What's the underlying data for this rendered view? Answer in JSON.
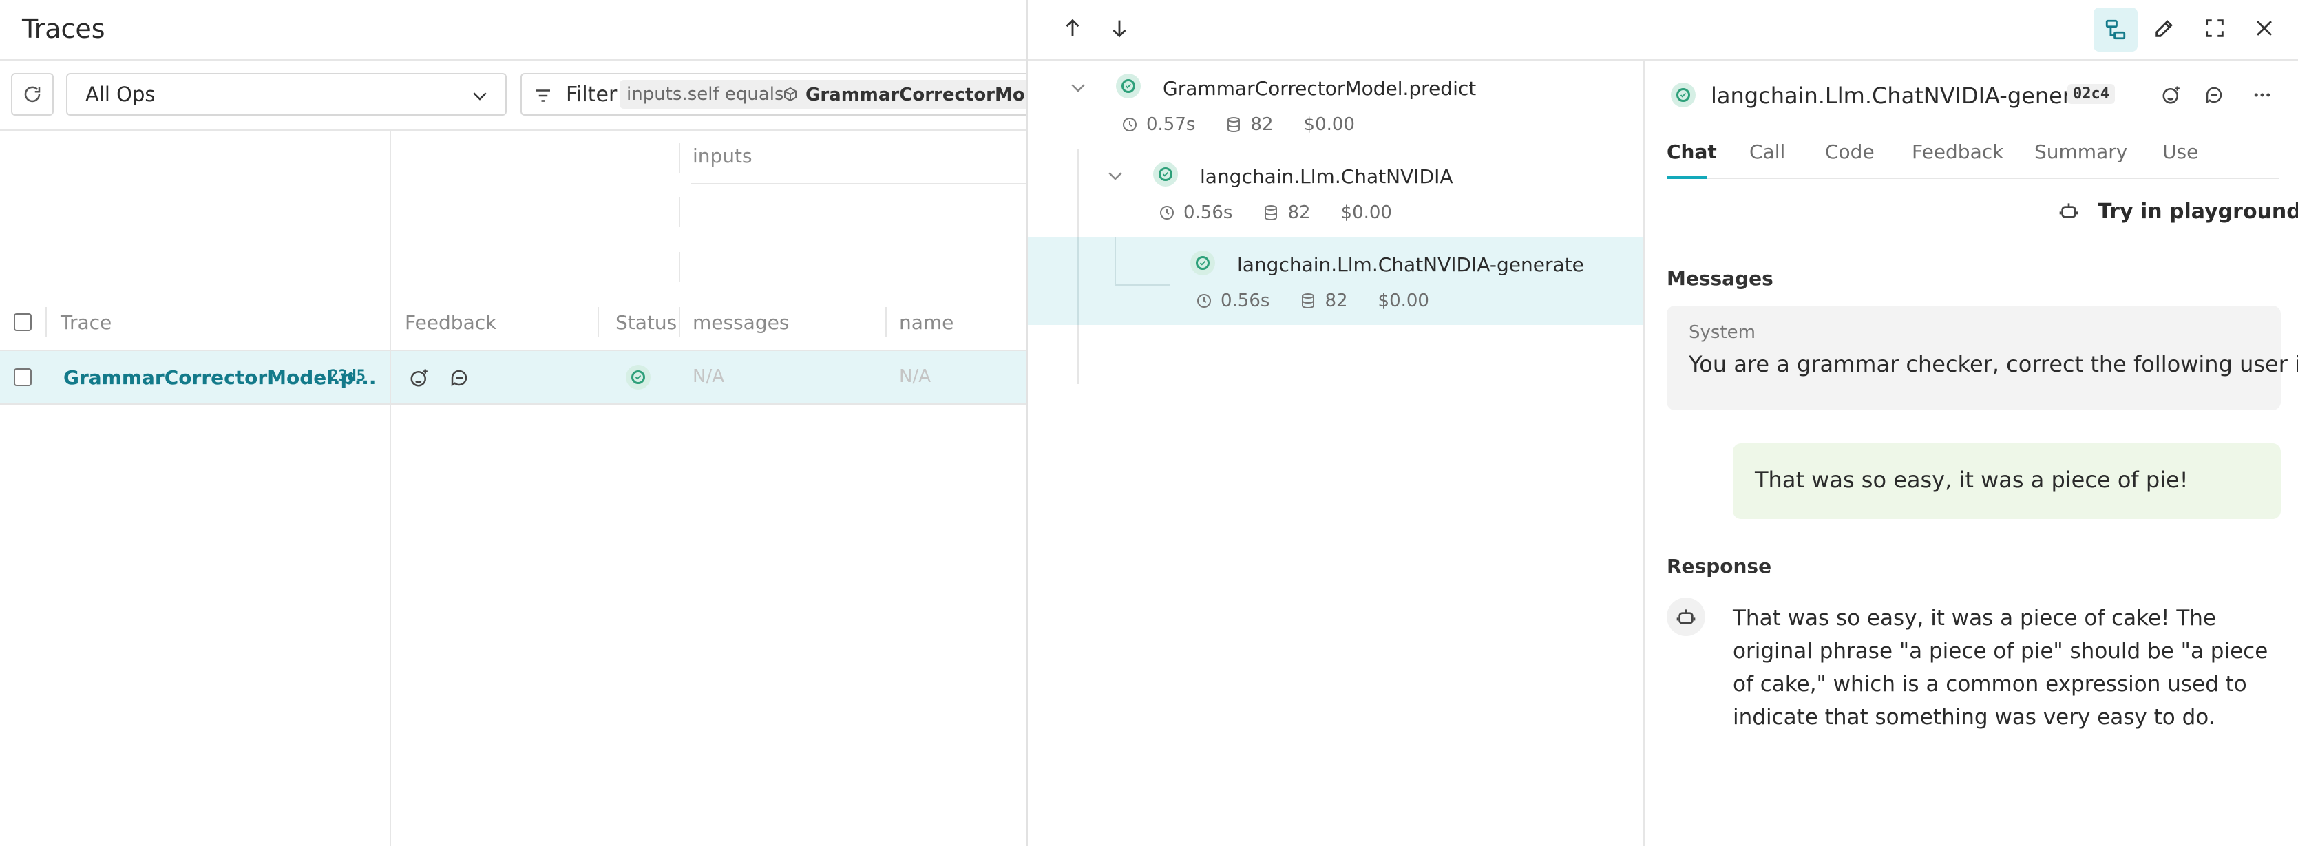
{
  "header": {
    "title": "Traces"
  },
  "toolbar": {
    "op_select": "All Ops",
    "filter_label": "Filter",
    "filter_chip_field": "inputs.self equals",
    "filter_chip_value": "GrammarCorrectorModel"
  },
  "table": {
    "group_header": "inputs",
    "columns": {
      "trace": "Trace",
      "feedback": "Feedback",
      "status": "Status",
      "messages": "messages",
      "name": "name"
    },
    "rows": [
      {
        "trace": "GrammarCorrectorModel.p...",
        "id": "23d5",
        "messages": "N/A",
        "name": "N/A"
      }
    ]
  },
  "tree": {
    "nodes": [
      {
        "label": "GrammarCorrectorModel.predict",
        "duration": "0.57s",
        "tokens": "82",
        "cost": "$0.00"
      },
      {
        "label": "langchain.Llm.ChatNVIDIA",
        "duration": "0.56s",
        "tokens": "82",
        "cost": "$0.00"
      },
      {
        "label": "langchain.Llm.ChatNVIDIA-generate",
        "duration": "0.56s",
        "tokens": "82",
        "cost": "$0.00"
      }
    ]
  },
  "detail": {
    "title": "langchain.Llm.ChatNVIDIA-generate",
    "id": "02c4",
    "tabs": [
      "Chat",
      "Call",
      "Code",
      "Feedback",
      "Summary",
      "Use"
    ],
    "active_tab": "Chat",
    "playground_button": "Try in playground",
    "messages_heading": "Messages",
    "system_label": "System",
    "system_text": "You are a grammar checker, correct the following user input.",
    "user_text": "That was so easy, it was a piece of pie!",
    "response_heading": "Response",
    "response_text": "That was so easy, it was a piece of cake! The original phrase \"a piece of pie\" should be \"a piece of cake,\" which is a common expression used to indicate that something was very easy to do."
  },
  "colors": {
    "accent": "#13a9ba",
    "success": "#2ea07a",
    "highlight": "#e4f5f7",
    "user_bubble": "#eef7e8"
  },
  "icons": [
    "refresh-icon",
    "chevron-down-icon",
    "filter-icon",
    "cube-icon",
    "arrow-up-icon",
    "arrow-down-icon",
    "tree-view-icon",
    "pencil-icon",
    "fullscreen-icon",
    "close-icon",
    "check-circle-icon",
    "clock-icon",
    "database-icon",
    "add-reaction-icon",
    "comment-icon",
    "more-icon",
    "robot-icon"
  ]
}
